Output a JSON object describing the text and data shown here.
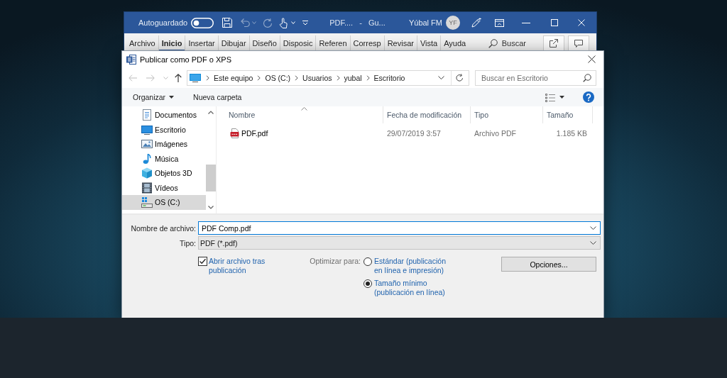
{
  "word_window": {
    "autosave_label": "Autoguardado",
    "autosave_on": false,
    "document_title": "PDF.... - Gu...",
    "user_name": "Yúbal FM",
    "avatar_initials": "YF"
  },
  "ribbon": {
    "tabs": [
      {
        "label": "Archivo",
        "selected": false
      },
      {
        "label": "Inicio",
        "selected": true
      },
      {
        "label": "Insertar",
        "selected": false
      },
      {
        "label": "Dibujar",
        "selected": false
      },
      {
        "label": "Diseño",
        "selected": false
      },
      {
        "label": "Disposic",
        "selected": false
      },
      {
        "label": "Referen",
        "selected": false
      },
      {
        "label": "Corresp",
        "selected": false
      },
      {
        "label": "Revisar",
        "selected": false
      },
      {
        "label": "Vista",
        "selected": false
      },
      {
        "label": "Ayuda",
        "selected": false
      }
    ],
    "search_label": "Buscar"
  },
  "dialog": {
    "title": "Publicar como PDF o XPS",
    "breadcrumb": [
      "Este equipo",
      "OS (C:)",
      "Usuarios",
      "yubal",
      "Escritorio"
    ],
    "search": {
      "placeholder": "Buscar en Escritorio"
    },
    "toolbar": {
      "organize": "Organizar",
      "new_folder": "Nueva carpeta"
    },
    "nav_items": [
      {
        "kind": "documents",
        "label": "Documentos",
        "selected": false
      },
      {
        "kind": "desktop",
        "label": "Escritorio",
        "selected": false
      },
      {
        "kind": "pictures",
        "label": "Imágenes",
        "selected": false
      },
      {
        "kind": "music",
        "label": "Música",
        "selected": false
      },
      {
        "kind": "objects3d",
        "label": "Objetos 3D",
        "selected": false
      },
      {
        "kind": "videos",
        "label": "Vídeos",
        "selected": false
      },
      {
        "kind": "drive",
        "label": "OS (C:)",
        "selected": true
      }
    ],
    "file_list": {
      "columns": [
        {
          "label": "Nombre",
          "sorted": true
        },
        {
          "label": "Fecha de modificación",
          "sorted": false
        },
        {
          "label": "Tipo",
          "sorted": false
        },
        {
          "label": "Tamaño",
          "sorted": false
        }
      ],
      "rows": [
        {
          "name": "PDF.pdf",
          "date": "29/07/2019 3:57",
          "type": "Archivo PDF",
          "size": "1.185 KB"
        }
      ]
    },
    "file_name": {
      "label": "Nombre de archivo:",
      "value": "PDF Comp.pdf"
    },
    "file_type": {
      "label": "Tipo:",
      "value": "PDF (*.pdf)"
    },
    "open_after": {
      "label": "Abrir archivo tras publicación",
      "checked": true
    },
    "optimize": {
      "label": "Optimizar para:",
      "options": [
        {
          "label": "Estándar (publicación en línea e impresión)",
          "selected": false
        },
        {
          "label": "Tamaño mínimo (publicación en línea)",
          "selected": true
        }
      ]
    },
    "options_button": "Opciones..."
  }
}
